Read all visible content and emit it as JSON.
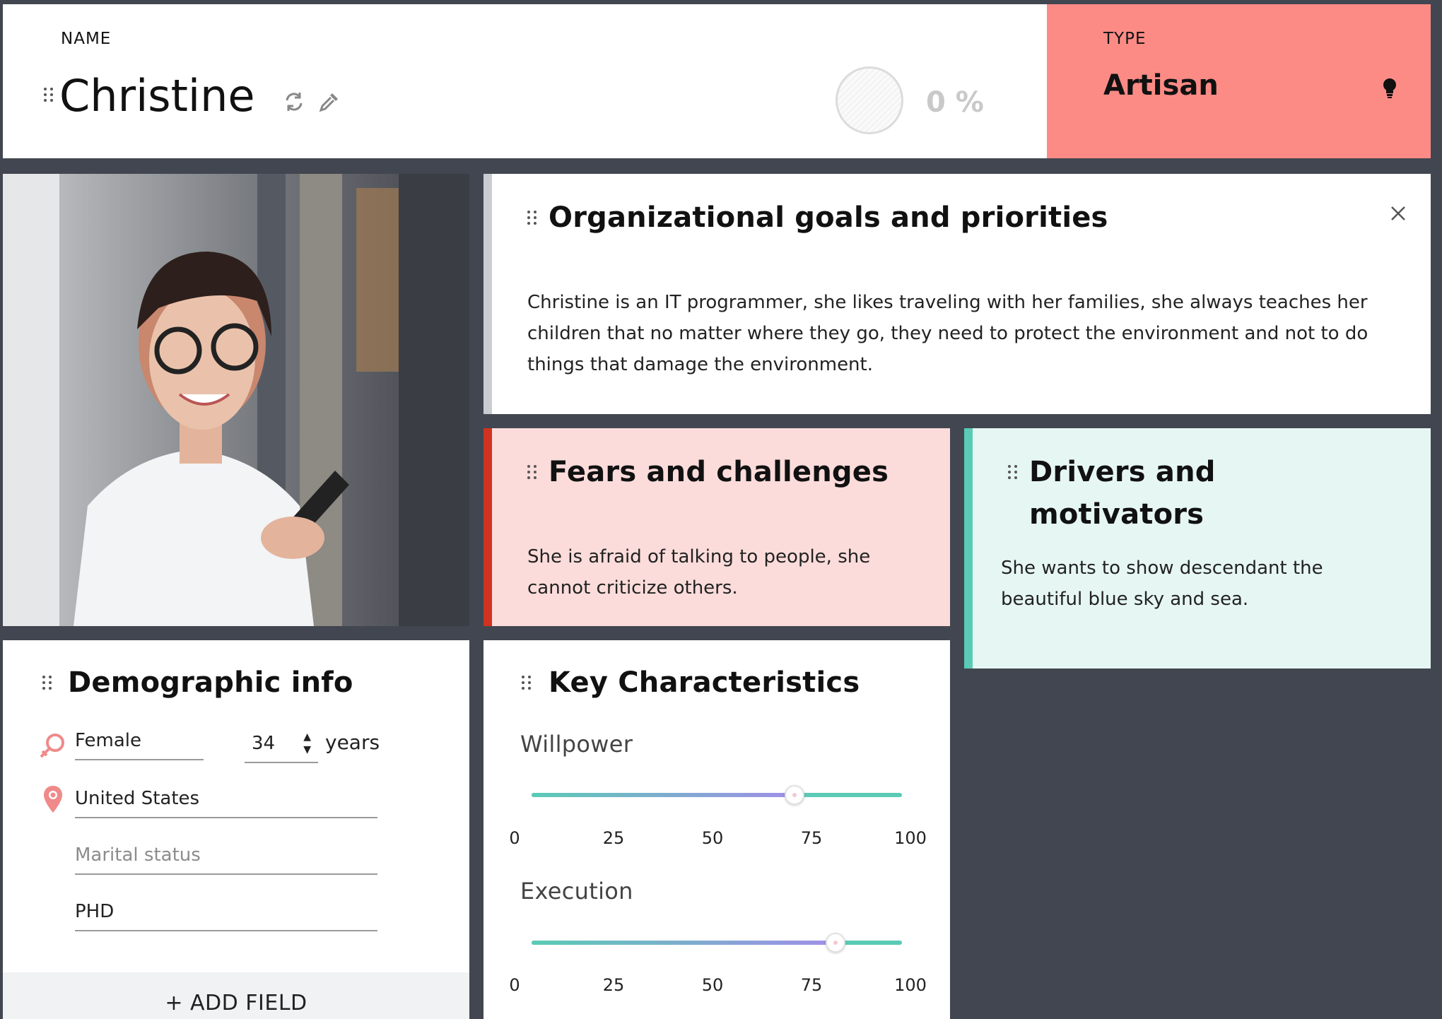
{
  "header": {
    "name_label": "NAME",
    "name_value": "Christine",
    "progress_text": "0 %",
    "type_label": "TYPE",
    "type_value": "Artisan"
  },
  "colors": {
    "type_background": "#fc8b86",
    "fears_accent": "#d0331f",
    "drivers_accent": "#5acbb5",
    "slider_gradient_end": "#a08fe8"
  },
  "org_goals": {
    "title": "Organizational goals and priorities",
    "text": "Christine is an IT programmer, she likes traveling with her families, she always teaches her children that no matter where they go, they need to protect the environment and not to do things that damage the environment."
  },
  "fears": {
    "title": "Fears and challenges",
    "text": "She is afraid of talking to people, she cannot criticize others."
  },
  "drivers": {
    "title_line1": "Drivers and",
    "title_line2": "motivators",
    "text": "She wants to show descendant the beautiful blue sky and sea."
  },
  "demographic": {
    "title": "Demographic info",
    "gender": "Female",
    "age": "34",
    "age_unit": "years",
    "location": "United States",
    "marital_placeholder": "Marital status",
    "education": "PHD",
    "add_field": "+ ADD FIELD"
  },
  "key_characteristics": {
    "title": "Key Characteristics",
    "ticks": [
      "0",
      "25",
      "50",
      "75",
      "100"
    ],
    "sliders": [
      {
        "label": "Willpower",
        "value": 71
      },
      {
        "label": "Execution",
        "value": 82
      }
    ]
  },
  "icons": {
    "refresh": "refresh-icon",
    "picker": "color-picker-icon",
    "bulb": "lightbulb-icon",
    "close": "close-icon",
    "gender": "female-icon",
    "location": "location-pin-icon"
  }
}
